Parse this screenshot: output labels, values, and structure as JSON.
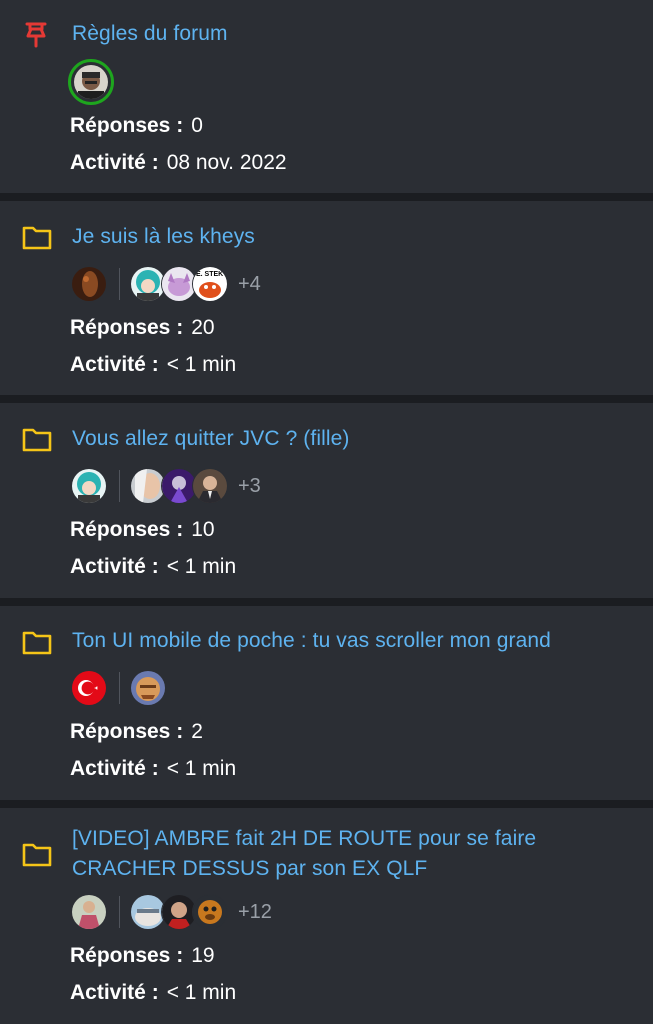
{
  "labels": {
    "replies": "Réponses :",
    "activity": "Activité :"
  },
  "topics": [
    {
      "icon": "pin-icon",
      "title": "Règles du forum",
      "avatars_left": [
        "avatar-moderator"
      ],
      "avatars_right": [],
      "more": "",
      "replies": "0",
      "activity": "08 nov. 2022"
    },
    {
      "icon": "folder-icon",
      "title": "Je suis là les kheys",
      "avatars_left": [
        "avatar-author"
      ],
      "avatars_right": [
        "avatar-1",
        "avatar-2",
        "avatar-3"
      ],
      "more": "+4",
      "replies": "20",
      "activity": "< 1 min"
    },
    {
      "icon": "folder-icon",
      "title": "Vous allez quitter JVC ? (fille)",
      "avatars_left": [
        "avatar-author"
      ],
      "avatars_right": [
        "avatar-1",
        "avatar-2",
        "avatar-3"
      ],
      "more": "+3",
      "replies": "10",
      "activity": "< 1 min"
    },
    {
      "icon": "folder-icon",
      "title": "Ton UI mobile de poche : tu vas scroller mon grand",
      "avatars_left": [
        "avatar-author-flag"
      ],
      "avatars_right": [
        "avatar-1"
      ],
      "more": "",
      "replies": "2",
      "activity": "< 1 min"
    },
    {
      "icon": "folder-icon",
      "title": "[VIDEO] AMBRE fait 2H DE ROUTE pour se faire CRACHER DESSUS par son EX QLF",
      "avatars_left": [
        "avatar-author"
      ],
      "avatars_right": [
        "avatar-1",
        "avatar-2",
        "avatar-3"
      ],
      "more": "+12",
      "replies": "19",
      "activity": "< 1 min"
    }
  ],
  "colors": {
    "link": "#5eb3f0",
    "pin": "#e53935",
    "folder": "#f5c518",
    "card": "#2b2e34",
    "divider": "#1b1d21",
    "online_ring": "#1ea61e"
  }
}
